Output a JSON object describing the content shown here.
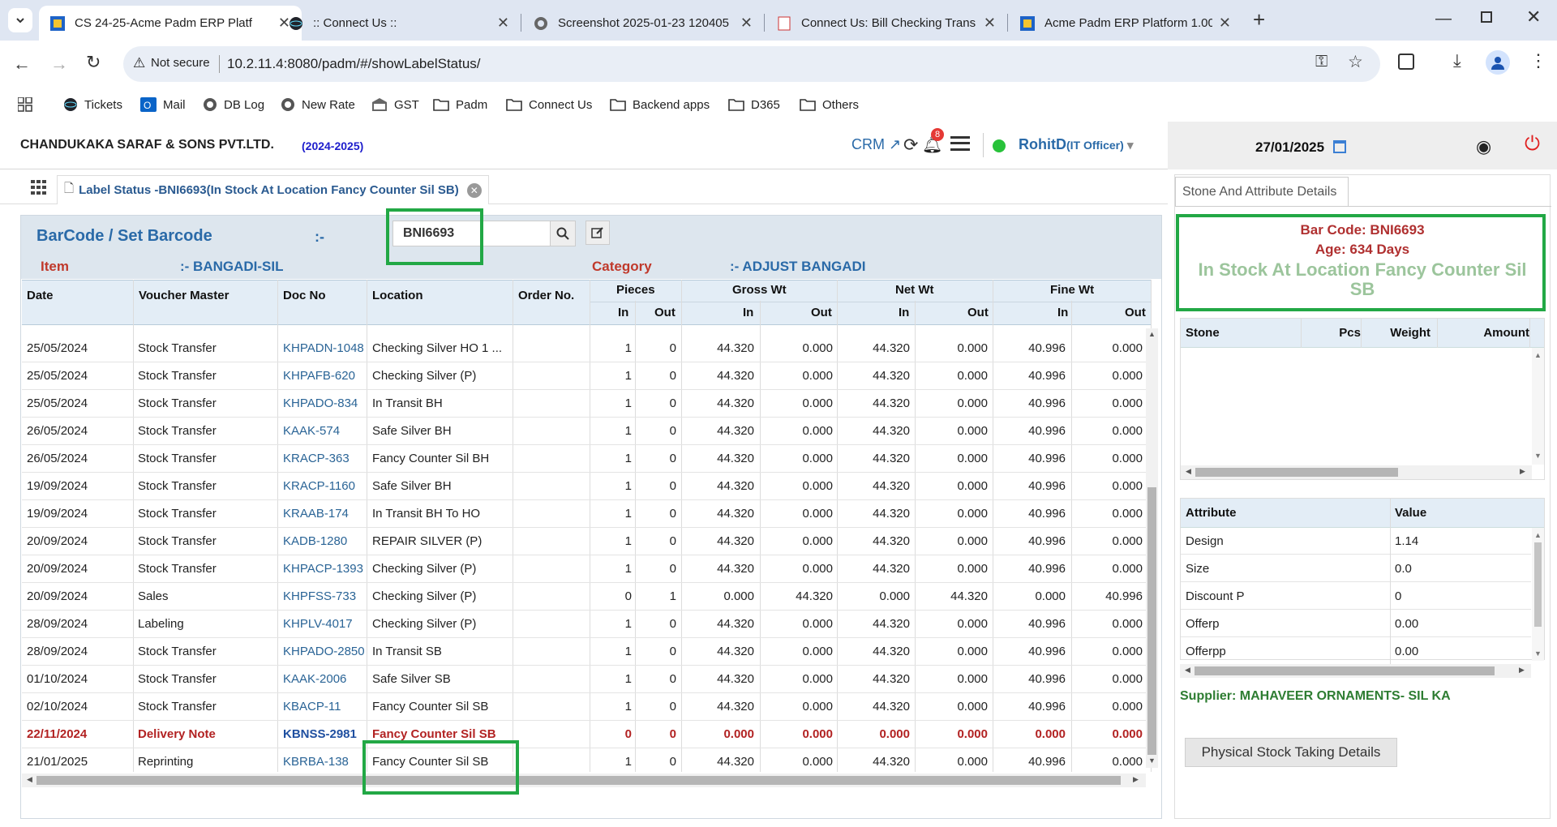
{
  "browser": {
    "tabs": [
      {
        "title": "CS 24-25-Acme Padm ERP Platf",
        "active": true
      },
      {
        "title": ":: Connect Us ::",
        "active": false
      },
      {
        "title": "Screenshot 2025-01-23 120405",
        "active": false
      },
      {
        "title": "Connect Us: Bill Checking Trans",
        "active": false
      },
      {
        "title": "Acme Padm ERP Platform 1.00",
        "active": false
      }
    ],
    "security_label": "Not secure",
    "url": "10.2.11.4:8080/padm/#/showLabelStatus/",
    "bookmarks": [
      "Tickets",
      "Mail",
      "DB Log",
      "New Rate",
      "GST",
      "Padm",
      "Connect Us",
      "Backend apps",
      "D365",
      "Others"
    ]
  },
  "header": {
    "company": "CHANDUKAKA SARAF & SONS PVT.LTD.",
    "year": "(2024-2025)",
    "crm": "CRM",
    "notif_count": "8",
    "user": "RohitD",
    "role": "(IT Officer)",
    "date": "27/01/2025"
  },
  "page_tab": {
    "title": "Label Status -BNI6693(In Stock At Location Fancy Counter Sil SB)"
  },
  "search": {
    "label": "BarCode / Set Barcode",
    "sep": ":-",
    "value": "BNI6693",
    "item_label": "Item",
    "item_value": ":- BANGADI-SIL",
    "category_label": "Category",
    "category_value": ":- ADJUST BANGADI"
  },
  "table": {
    "headers": {
      "date": "Date",
      "voucher": "Voucher Master",
      "doc": "Doc No",
      "location": "Location",
      "order": "Order No.",
      "pieces": "Pieces",
      "gross": "Gross Wt",
      "net": "Net Wt",
      "fine": "Fine Wt",
      "in": "In",
      "out": "Out"
    },
    "rows": [
      {
        "date": "25/05/2024",
        "voucher": "Stock Transfer",
        "doc": "KHPADN-1048",
        "location": "Checking Silver HO 1 ...",
        "order": "",
        "pin": "1",
        "pout": "0",
        "gin": "44.320",
        "gout": "0.000",
        "nin": "44.320",
        "nout": "0.000",
        "fin": "40.996",
        "fout": "0.000",
        "highlight": false
      },
      {
        "date": "25/05/2024",
        "voucher": "Stock Transfer",
        "doc": "KHPAFB-620",
        "location": "Checking Silver (P)",
        "order": "",
        "pin": "1",
        "pout": "0",
        "gin": "44.320",
        "gout": "0.000",
        "nin": "44.320",
        "nout": "0.000",
        "fin": "40.996",
        "fout": "0.000",
        "highlight": false
      },
      {
        "date": "25/05/2024",
        "voucher": "Stock Transfer",
        "doc": "KHPADO-834",
        "location": "In Transit BH",
        "order": "",
        "pin": "1",
        "pout": "0",
        "gin": "44.320",
        "gout": "0.000",
        "nin": "44.320",
        "nout": "0.000",
        "fin": "40.996",
        "fout": "0.000",
        "highlight": false
      },
      {
        "date": "26/05/2024",
        "voucher": "Stock Transfer",
        "doc": "KAAK-574",
        "location": "Safe Silver BH",
        "order": "",
        "pin": "1",
        "pout": "0",
        "gin": "44.320",
        "gout": "0.000",
        "nin": "44.320",
        "nout": "0.000",
        "fin": "40.996",
        "fout": "0.000",
        "highlight": false
      },
      {
        "date": "26/05/2024",
        "voucher": "Stock Transfer",
        "doc": "KRACP-363",
        "location": "Fancy Counter Sil BH",
        "order": "",
        "pin": "1",
        "pout": "0",
        "gin": "44.320",
        "gout": "0.000",
        "nin": "44.320",
        "nout": "0.000",
        "fin": "40.996",
        "fout": "0.000",
        "highlight": false
      },
      {
        "date": "19/09/2024",
        "voucher": "Stock Transfer",
        "doc": "KRACP-1160",
        "location": "Safe Silver BH",
        "order": "",
        "pin": "1",
        "pout": "0",
        "gin": "44.320",
        "gout": "0.000",
        "nin": "44.320",
        "nout": "0.000",
        "fin": "40.996",
        "fout": "0.000",
        "highlight": false
      },
      {
        "date": "19/09/2024",
        "voucher": "Stock Transfer",
        "doc": "KRAAB-174",
        "location": "In Transit BH To HO",
        "order": "",
        "pin": "1",
        "pout": "0",
        "gin": "44.320",
        "gout": "0.000",
        "nin": "44.320",
        "nout": "0.000",
        "fin": "40.996",
        "fout": "0.000",
        "highlight": false
      },
      {
        "date": "20/09/2024",
        "voucher": "Stock Transfer",
        "doc": "KADB-1280",
        "location": "REPAIR SILVER (P)",
        "order": "",
        "pin": "1",
        "pout": "0",
        "gin": "44.320",
        "gout": "0.000",
        "nin": "44.320",
        "nout": "0.000",
        "fin": "40.996",
        "fout": "0.000",
        "highlight": false
      },
      {
        "date": "20/09/2024",
        "voucher": "Stock Transfer",
        "doc": "KHPACP-1393",
        "location": "Checking Silver (P)",
        "order": "",
        "pin": "1",
        "pout": "0",
        "gin": "44.320",
        "gout": "0.000",
        "nin": "44.320",
        "nout": "0.000",
        "fin": "40.996",
        "fout": "0.000",
        "highlight": false
      },
      {
        "date": "20/09/2024",
        "voucher": "Sales",
        "doc": "KHPFSS-733",
        "location": "Checking Silver (P)",
        "order": "",
        "pin": "0",
        "pout": "1",
        "gin": "0.000",
        "gout": "44.320",
        "nin": "0.000",
        "nout": "44.320",
        "fin": "0.000",
        "fout": "40.996",
        "highlight": false
      },
      {
        "date": "28/09/2024",
        "voucher": "Labeling",
        "doc": "KHPLV-4017",
        "location": "Checking Silver (P)",
        "order": "",
        "pin": "1",
        "pout": "0",
        "gin": "44.320",
        "gout": "0.000",
        "nin": "44.320",
        "nout": "0.000",
        "fin": "40.996",
        "fout": "0.000",
        "highlight": false
      },
      {
        "date": "28/09/2024",
        "voucher": "Stock Transfer",
        "doc": "KHPADO-2850",
        "location": "In Transit SB",
        "order": "",
        "pin": "1",
        "pout": "0",
        "gin": "44.320",
        "gout": "0.000",
        "nin": "44.320",
        "nout": "0.000",
        "fin": "40.996",
        "fout": "0.000",
        "highlight": false
      },
      {
        "date": "01/10/2024",
        "voucher": "Stock Transfer",
        "doc": "KAAK-2006",
        "location": "Safe Silver SB",
        "order": "",
        "pin": "1",
        "pout": "0",
        "gin": "44.320",
        "gout": "0.000",
        "nin": "44.320",
        "nout": "0.000",
        "fin": "40.996",
        "fout": "0.000",
        "highlight": false
      },
      {
        "date": "02/10/2024",
        "voucher": "Stock Transfer",
        "doc": "KBACP-11",
        "location": "Fancy Counter Sil SB",
        "order": "",
        "pin": "1",
        "pout": "0",
        "gin": "44.320",
        "gout": "0.000",
        "nin": "44.320",
        "nout": "0.000",
        "fin": "40.996",
        "fout": "0.000",
        "highlight": false
      },
      {
        "date": "22/11/2024",
        "voucher": "Delivery Note",
        "doc": "KBNSS-2981",
        "location": "Fancy Counter Sil SB",
        "order": "",
        "pin": "0",
        "pout": "0",
        "gin": "0.000",
        "gout": "0.000",
        "nin": "0.000",
        "nout": "0.000",
        "fin": "0.000",
        "fout": "0.000",
        "highlight": true
      },
      {
        "date": "21/01/2025",
        "voucher": "Reprinting",
        "doc": "KBRBA-138",
        "location": "Fancy Counter Sil SB",
        "order": "",
        "pin": "1",
        "pout": "0",
        "gin": "44.320",
        "gout": "0.000",
        "nin": "44.320",
        "nout": "0.000",
        "fin": "40.996",
        "fout": "0.000",
        "highlight": false
      }
    ]
  },
  "right": {
    "tab": "Stone And Attribute Details",
    "barcode_line": "Bar Code: BNI6693",
    "age_line": "Age: 634 Days",
    "status_line": "In Stock At Location Fancy Counter Sil SB",
    "stone_headers": {
      "stone": "Stone",
      "pcs": "Pcs",
      "weight": "Weight",
      "amount": "Amount"
    },
    "attr_headers": {
      "attribute": "Attribute",
      "value": "Value"
    },
    "attributes": [
      {
        "name": "Design",
        "value": "1.14"
      },
      {
        "name": "Size",
        "value": "0.0"
      },
      {
        "name": "Discount P",
        "value": "0"
      },
      {
        "name": "Offerp",
        "value": "0.00"
      },
      {
        "name": "Offerpp",
        "value": "0.00"
      }
    ],
    "supplier": "Supplier: MAHAVEER ORNAMENTS- SIL KA",
    "physical_btn": "Physical Stock Taking Details"
  },
  "colors": {
    "accent_blue": "#2a6aa8",
    "delivery_red": "#b22222",
    "highlight_green": "#22a845",
    "item_red": "#c0392b"
  }
}
